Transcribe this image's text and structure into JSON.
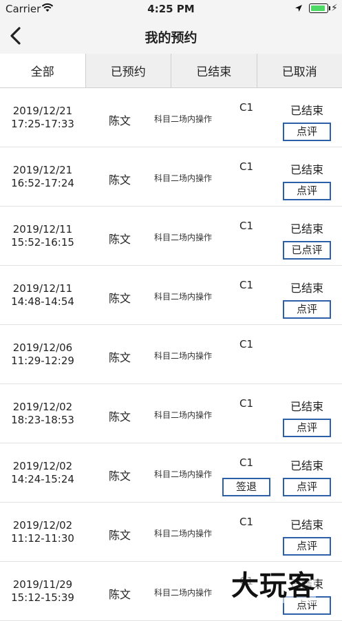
{
  "status_bar": {
    "carrier": "Carrier",
    "time": "4:25 PM",
    "battery_level": 1.0
  },
  "nav": {
    "title": "我的预约"
  },
  "tabs": [
    {
      "label": "全部",
      "active": true
    },
    {
      "label": "已预约",
      "active": false
    },
    {
      "label": "已结束",
      "active": false
    },
    {
      "label": "已取消",
      "active": false
    }
  ],
  "rows": [
    {
      "date": "2019/12/21",
      "time": "17:25-17:33",
      "name": "陈文",
      "subject": "科目二场内操作",
      "class": "C1",
      "status": "已结束",
      "review": "点评",
      "signout": ""
    },
    {
      "date": "2019/12/21",
      "time": "16:52-17:24",
      "name": "陈文",
      "subject": "科目二场内操作",
      "class": "C1",
      "status": "已结束",
      "review": "点评",
      "signout": ""
    },
    {
      "date": "2019/12/11",
      "time": "15:52-16:15",
      "name": "陈文",
      "subject": "科目二场内操作",
      "class": "C1",
      "status": "已结束",
      "review": "已点评",
      "signout": ""
    },
    {
      "date": "2019/12/11",
      "time": "14:48-14:54",
      "name": "陈文",
      "subject": "科目二场内操作",
      "class": "C1",
      "status": "已结束",
      "review": "点评",
      "signout": ""
    },
    {
      "date": "2019/12/06",
      "time": "11:29-12:29",
      "name": "陈文",
      "subject": "科目二场内操作",
      "class": "C1",
      "status": "",
      "review": "",
      "signout": ""
    },
    {
      "date": "2019/12/02",
      "time": "18:23-18:53",
      "name": "陈文",
      "subject": "科目二场内操作",
      "class": "C1",
      "status": "已结束",
      "review": "点评",
      "signout": ""
    },
    {
      "date": "2019/12/02",
      "time": "14:24-15:24",
      "name": "陈文",
      "subject": "科目二场内操作",
      "class": "C1",
      "status": "已结束",
      "review": "点评",
      "signout": "签退"
    },
    {
      "date": "2019/12/02",
      "time": "11:12-11:30",
      "name": "陈文",
      "subject": "科目二场内操作",
      "class": "C1",
      "status": "已结束",
      "review": "点评",
      "signout": ""
    },
    {
      "date": "2019/11/29",
      "time": "15:12-15:39",
      "name": "陈文",
      "subject": "科目二场内操作",
      "class": "C1",
      "status": "已结束",
      "review": "点评",
      "signout": ""
    }
  ],
  "watermark": "大玩客",
  "colors": {
    "button_border": "#2b5fa8",
    "battery": "#4cd964"
  }
}
